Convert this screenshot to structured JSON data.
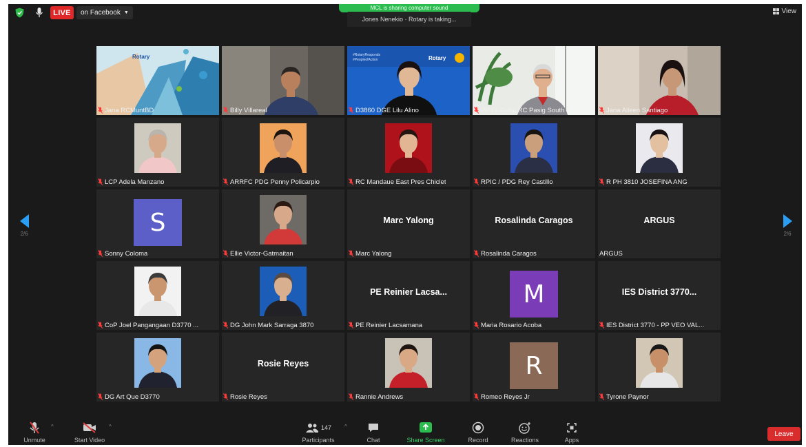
{
  "topbar": {
    "live_label": "LIVE",
    "stream_target": "on Facebook",
    "sharing_banner": "MCL is sharing computer sound",
    "active_speaker": "Jones Nenekio · Rotary is taking...",
    "view_label": "View"
  },
  "pagination": {
    "left_page": "2/6",
    "right_page": "2/6"
  },
  "participants": [
    {
      "name": "Jana RCMuntBD",
      "kind": "video",
      "muted": true,
      "scene": "rotary-banner"
    },
    {
      "name": "Billy Villareal",
      "kind": "video",
      "muted": true,
      "scene": "room-man"
    },
    {
      "name": "D3860 DGE Lilu Alino",
      "kind": "video",
      "muted": true,
      "scene": "rotary-blue"
    },
    {
      "name": "PP Fil Guba RC Pasig South",
      "kind": "video",
      "muted": true,
      "scene": "plant-room"
    },
    {
      "name": "Jana Aileen Santiago",
      "kind": "video",
      "muted": true,
      "scene": "woman-room"
    },
    {
      "name": "LCP Adela Manzano",
      "kind": "photo",
      "muted": true,
      "photo_bg": "#cfcac0",
      "skin": "#d6a98a",
      "hair": "#b9b4ad",
      "shirt": "#f2c7c7"
    },
    {
      "name": "ARRFC PDG Penny Policarpio",
      "kind": "photo",
      "muted": true,
      "photo_bg": "#f0a35a",
      "skin": "#c98f6a",
      "hair": "#1c140e",
      "shirt": "#1e1e24"
    },
    {
      "name": "RC Mandaue East Pres Chiclet",
      "kind": "photo",
      "muted": true,
      "photo_bg": "#b0121b",
      "skin": "#e2b694",
      "hair": "#241510",
      "shirt": "#7a0d12"
    },
    {
      "name": "RPIC / PDG Rey Castillo",
      "kind": "photo",
      "muted": true,
      "photo_bg": "#2a4fb0",
      "skin": "#caa07c",
      "hair": "#1a1410",
      "shirt": "#2b2f46"
    },
    {
      "name": "R PH 3810 JOSEFINA ANG",
      "kind": "photo",
      "muted": true,
      "photo_bg": "#e9e9ee",
      "skin": "#e3c0a0",
      "hair": "#1a1212",
      "shirt": "#2a2e40"
    },
    {
      "name": "Sonny Coloma",
      "kind": "avatar",
      "muted": true,
      "letter": "S",
      "color": "#5b5fc7"
    },
    {
      "name": "Ellie Victor-Gatmaitan",
      "kind": "photo",
      "muted": true,
      "photo_bg": "#6e6a66",
      "skin": "#d7a889",
      "hair": "#2a1a12",
      "shirt": "#d23a3a"
    },
    {
      "name": "Marc Yalong",
      "kind": "text",
      "muted": true,
      "label": "Marc Yalong"
    },
    {
      "name": "Rosalinda Caragos",
      "kind": "text",
      "muted": true,
      "label": "Rosalinda Caragos"
    },
    {
      "name": "ARGUS",
      "kind": "text",
      "muted": false,
      "label": "ARGUS"
    },
    {
      "name": "CoP Joel Pangangaan D3770 ...",
      "kind": "photo",
      "muted": true,
      "photo_bg": "#f2f2f2",
      "skin": "#c99670",
      "hair": "#3b3b3b",
      "shirt": "#e8e8e8"
    },
    {
      "name": "DG John Mark Sarraga 3870",
      "kind": "photo",
      "muted": true,
      "photo_bg": "#1c5db8",
      "skin": "#d8b090",
      "hair": "#5a4a40",
      "shirt": "#222226"
    },
    {
      "name": "PE Reinier Lacsamana",
      "kind": "text",
      "muted": true,
      "label": "PE Reinier Lacsa..."
    },
    {
      "name": "Maria Rosario Acoba",
      "kind": "avatar",
      "muted": true,
      "letter": "M",
      "color": "#7b3cb8"
    },
    {
      "name": "IES District 3770 - PP VEO VAL...",
      "kind": "text",
      "muted": true,
      "label": "IES District 3770..."
    },
    {
      "name": "DG Art Que D3770",
      "kind": "photo",
      "muted": true,
      "photo_bg": "#8ab8e6",
      "skin": "#d4a37e",
      "hair": "#141414",
      "shirt": "#202230"
    },
    {
      "name": "Rosie Reyes",
      "kind": "text",
      "muted": true,
      "label": "Rosie Reyes"
    },
    {
      "name": "Rannie Andrews",
      "kind": "photo",
      "muted": true,
      "photo_bg": "#c9c2b6",
      "skin": "#d9a884",
      "hair": "#1e1410",
      "shirt": "#c4202a"
    },
    {
      "name": "Romeo Reyes Jr",
      "kind": "avatar",
      "muted": true,
      "letter": "R",
      "color": "#8a6a57"
    },
    {
      "name": "Tyrone Paynor",
      "kind": "photo",
      "muted": true,
      "photo_bg": "#d2c7b4",
      "skin": "#c89068",
      "hair": "#181818",
      "shirt": "#e6e6e6"
    }
  ],
  "toolbar": {
    "unmute": "Unmute",
    "start_video": "Start Video",
    "participants": "Participants",
    "participants_count": "147",
    "chat": "Chat",
    "share_screen": "Share Screen",
    "record": "Record",
    "reactions": "Reactions",
    "apps": "Apps",
    "leave": "Leave"
  },
  "colors": {
    "live_red": "#e02828",
    "nav_blue": "#2a9df4",
    "share_green": "#3dd068",
    "leave_red": "#d92c2c",
    "bg": "#1a1a1a",
    "tile": "#262626"
  }
}
